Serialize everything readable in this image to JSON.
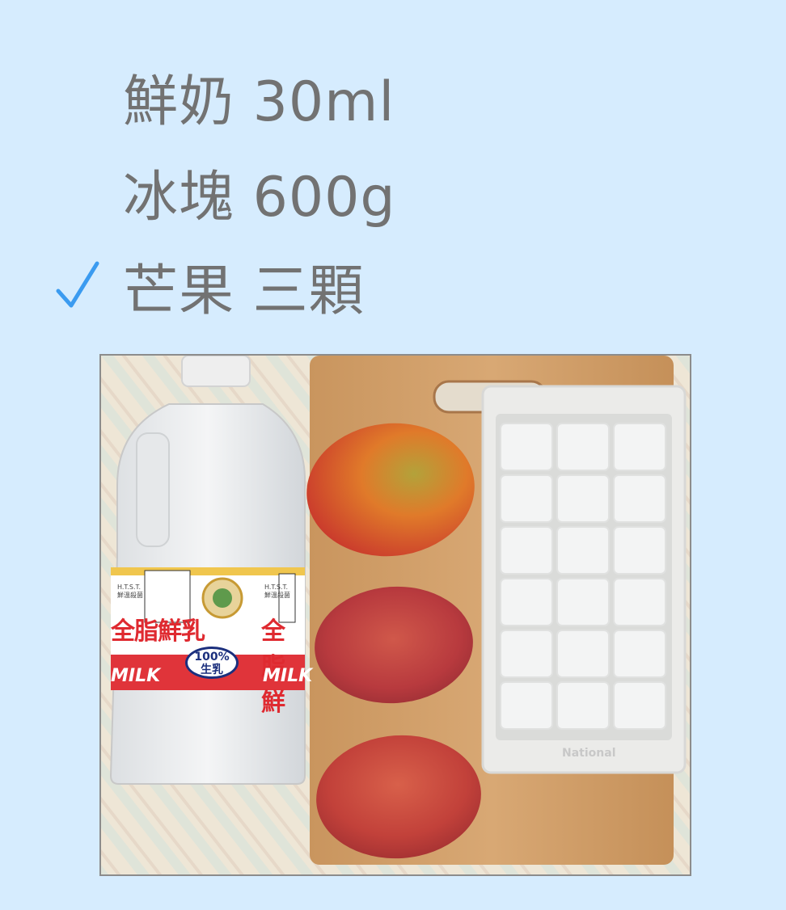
{
  "checklist": {
    "items": [
      {
        "label": "鮮奶 30ml",
        "checked": false
      },
      {
        "label": "冰塊 600g",
        "checked": false
      },
      {
        "label": "芒果 三顆",
        "checked": true
      }
    ],
    "check_color": "#3b9bf0",
    "text_color": "#727272"
  },
  "photo": {
    "milk_label_main": "全脂鮮乳",
    "milk_label_side": "全脂鮮",
    "milk_brand": "H.T.S.T.\n鮮溫殺菌",
    "milk_brand_side": "H.T.S.T.\n鮮溫殺菌",
    "milk_percent": "100%",
    "milk_percent_sub": "生乳",
    "milk_word": "MILK",
    "milk_word_side": "MILK",
    "tray_brand": "National"
  }
}
